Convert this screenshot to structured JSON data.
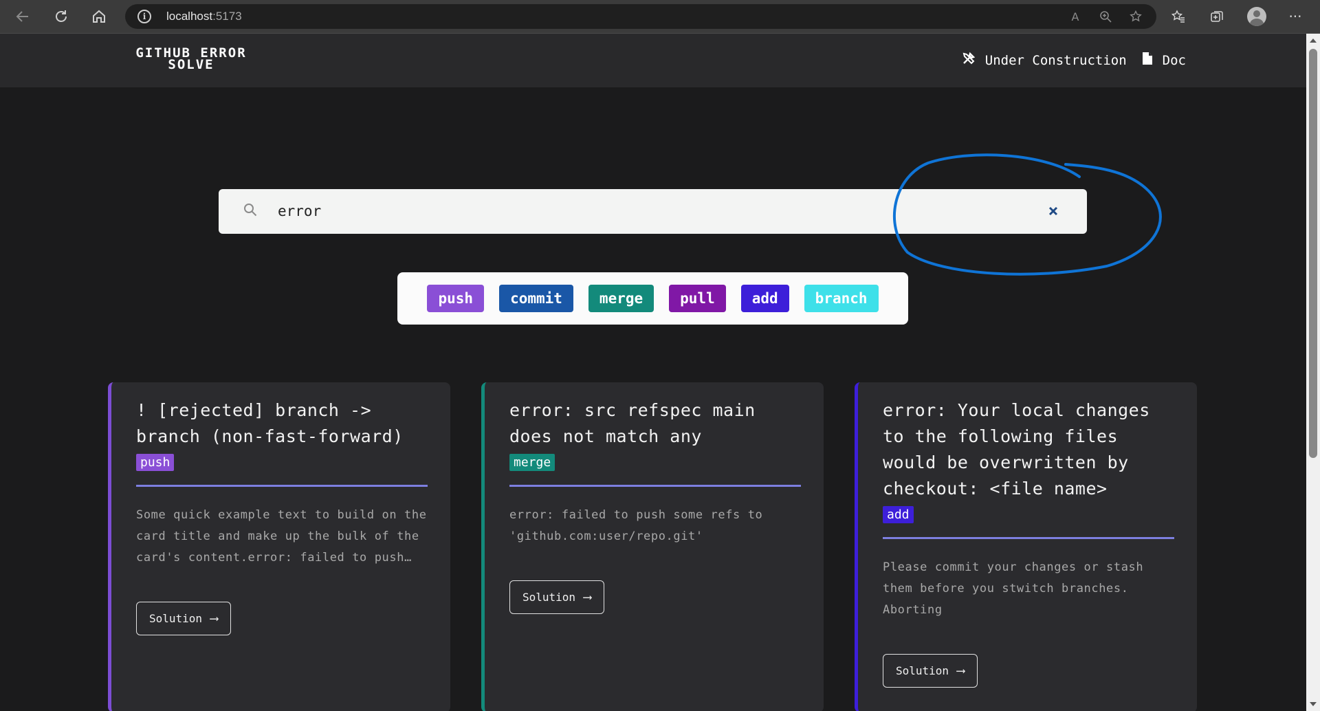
{
  "browser": {
    "url_host": "localhost",
    "url_port": ":5173"
  },
  "header": {
    "logo_line1": "GITHUB ERROR",
    "logo_line2": "SOLVE",
    "nav": [
      {
        "label": "Under Construction",
        "icon": "hammer-wrench-icon"
      },
      {
        "label": "Doc",
        "icon": "document-icon"
      }
    ]
  },
  "search": {
    "value": "error",
    "icon": "search-icon",
    "clear_icon": "close-icon"
  },
  "tags": [
    {
      "label": "push",
      "color": "#8a4fd6"
    },
    {
      "label": "commit",
      "color": "#1a57a7"
    },
    {
      "label": "merge",
      "color": "#138a7b"
    },
    {
      "label": "pull",
      "color": "#8018a6"
    },
    {
      "label": "add",
      "color": "#3d1fd9"
    },
    {
      "label": "branch",
      "color": "#3ee0e9"
    }
  ],
  "cards": [
    {
      "title": "! [rejected] branch -> branch (non-fast-forward)",
      "tag": "push",
      "tag_color": "#8a4fd6",
      "accent": "#7c4dd4",
      "text": "Some quick example text to build on the card title and make up the bulk of the card's content.error: failed to push some refs to",
      "button": "Solution"
    },
    {
      "title": "error: src refspec main does not match any",
      "tag": "merge",
      "tag_color": "#138a7b",
      "accent": "#138a7b",
      "text": "error: failed to push some refs to 'github.com:user/repo.git'",
      "button": "Solution"
    },
    {
      "title": "error: Your local changes to the following files would be overwritten by checkout: <file name>",
      "tag": "add",
      "tag_color": "#3d1fd9",
      "accent": "#3d1fd9",
      "text": "Please commit your changes or stash them before you stwitch branches. Aborting",
      "button": "Solution"
    }
  ],
  "colors": {
    "annotation": "#0f74d6",
    "divider": "#7d7fe0"
  }
}
